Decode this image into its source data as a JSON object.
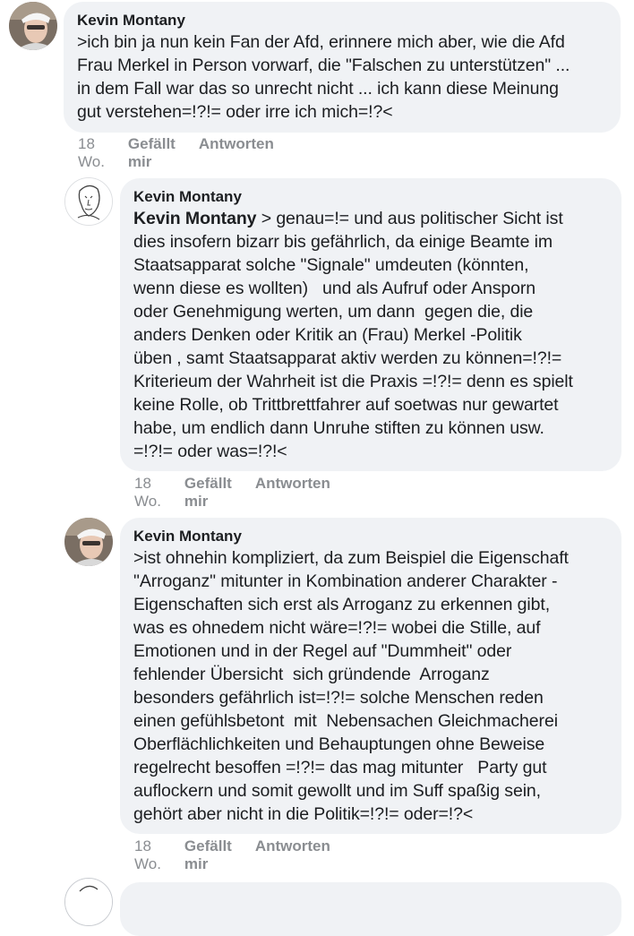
{
  "comments": [
    {
      "author": "Kevin Montany",
      "text": ">ich bin ja nun kein Fan der Afd, erinnere mich aber, wie die Afd\nFrau Merkel in Person vorwarf, die \"Falschen zu unterstützen\" ...\nin dem Fall war das so unrecht nicht ... ich kann diese Meinung\ngut verstehen=!?!= oder irre ich mich=!?<",
      "time": "18 Wo.",
      "like": "Gefällt mir",
      "reply": "Antworten"
    },
    {
      "author": "Kevin Montany",
      "mention": "Kevin Montany",
      "text": " > genau=!= und aus politischer Sicht ist\ndies insofern bizarr bis gefährlich, da einige Beamte im\nStaatsapparat solche \"Signale\" umdeuten (könnten,\nwenn diese es wollten)   und als Aufruf oder Ansporn\noder Genehmigung werten, um dann  gegen die, die\nanders Denken oder Kritik an (Frau) Merkel -Politik\nüben , samt Staatsapparat aktiv werden zu können=!?!=\nKriterieum der Wahrheit ist die Praxis =!?!= denn es spielt\nkeine Rolle, ob Trittbrettfahrer auf soetwas nur gewartet\nhabe, um endlich dann Unruhe stiften zu können usw.\n=!?!= oder was=!?!<",
      "time": "18 Wo.",
      "like": "Gefällt mir",
      "reply": "Antworten"
    },
    {
      "author": "Kevin Montany",
      "text": ">ist ohnehin kompliziert, da zum Beispiel die Eigenschaft\n\"Arroganz\" mitunter in Kombination anderer Charakter -\nEigenschaften sich erst als Arroganz zu erkennen gibt,\nwas es ohnedem nicht wäre=!?!= wobei die Stille, auf\nEmotionen und in der Regel auf \"Dummheit\" oder\nfehlender Übersicht  sich gründende  Arroganz\nbesonders gefährlich ist=!?!= solche Menschen reden\neinen gefühlsbetont  mit  Nebensachen Gleichmacherei\nOberflächlichkeiten und Behauptungen ohne Beweise\nregelrecht besoffen =!?!= das mag mitunter   Party gut\nauflockern und somit gewollt und im Suff spaßig sein,\ngehört aber nicht in die Politik=!?!= oder=!?<",
      "time": "18 Wo.",
      "like": "Gefällt mir",
      "reply": "Antworten"
    }
  ],
  "icons": {
    "avatar_photo": "user-photo-avatar",
    "avatar_sketch": "sketch-portrait-avatar"
  },
  "colors": {
    "bubble": "#f0f2f5",
    "meta_text": "#8a8d91",
    "text": "#1c1e21"
  }
}
